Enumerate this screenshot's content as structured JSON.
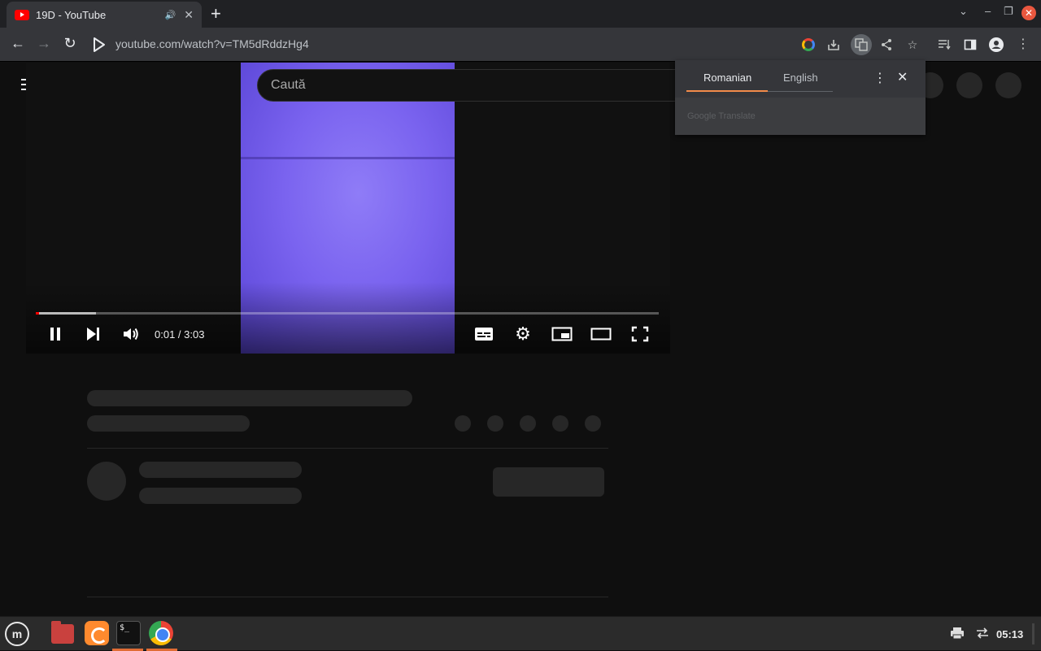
{
  "browser": {
    "tab": {
      "title": "19D - YouTube",
      "audio_icon": "speaker-icon",
      "close": "✕"
    },
    "new_tab": "+",
    "window": {
      "dropdown": "⌄",
      "minimize": "–",
      "maximize": "❐",
      "close": "✕"
    },
    "nav": {
      "back": "←",
      "forward": "→",
      "reload": "↻"
    },
    "url": "youtube.com/watch?v=TM5dRddzHg4"
  },
  "youtube": {
    "search_placeholder": "Caută",
    "player": {
      "time": "0:01 / 3:03",
      "progress_played_fraction": 0.005,
      "progress_buffered_fraction": 0.096
    }
  },
  "translate_popup": {
    "source_language": "Romanian",
    "target_language": "English",
    "more": "⋮",
    "close": "✕",
    "brand": "Google Translate"
  },
  "taskbar": {
    "menu_glyph": "m",
    "terminal_glyph": "$_",
    "clock": "05:13"
  },
  "colors": {
    "accent_red": "#ff0000",
    "translate_underline": "#f28b4a",
    "taskbar_active": "#e06c34"
  }
}
